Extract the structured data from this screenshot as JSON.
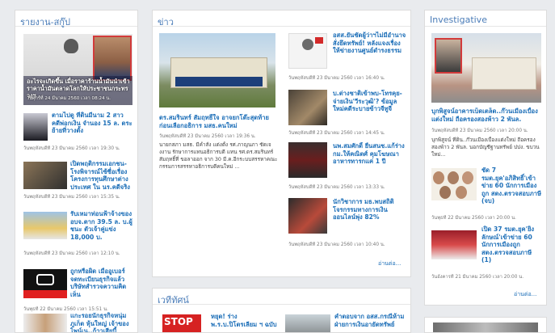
{
  "left": {
    "title": "รายงาน-สกู๊ป",
    "feature": {
      "caption": "อะไรจะเกิดขึ้น เมื่อราคาร้านน้ำมันนำเข้าราคาน้ำมันตลาดโลกให้ประชาชนกระทรวงฯ",
      "date": "วันศุกร์ที่ 24 มีนาคม 2560 เวลา 08:24 น."
    },
    "items": [
      {
        "headline": "ตามไปดู ที่ดินมีนาม 2 สาว คดีพ่อกเงิน จำนอง 15 ล. ตระย้ายที่วางตั้ง",
        "date": "วันพฤหัสบดีที่ 23 มีนาคม 2560 เวลา 19:30 น."
      },
      {
        "headline": "เปิดพฤติกรรมเอกชน-โรงพิจารณ์ไซ้ซื่อเรื่องโครงการทุนศึกษาต่างประเทศ ใน นร.คดีจริงเงิน",
        "date": "วันพฤหัสบดีที่ 23 มีนาคม 2560 เวลา 15:35 น."
      },
      {
        "headline": "รับเหมาท่อนฟ้าจ้างของ อบจ.ตาก 39.5 ล. บ.ผู้ชนะ ตัวเจ้าคู่แข่ง 18,000 บ.",
        "date": "วันพฤหัสบดีที่ 23 มีนาคม 2560 เวลา 12:10 น."
      },
      {
        "headline": "ถูกหรือผิด เมื่ออูเบอร์ จดทะเบียนธุรกิจแล้ว บริษัทสำรวจความคิดเห็น",
        "date": "วันพุธที่ 22 มีนาคม 2560 เวลา 15:51 น."
      },
      {
        "headline": "แกะรอยนักธุรกิจหนุ่มภูเก็ต หุ้นใหญ่ เจ้าของไพน์เน..ก้าวเสียบี้",
        "date": ""
      }
    ]
  },
  "middle": {
    "title": "ข่าว",
    "lead": {
      "headline": "ดร.สมรินทร์ สัมฤทธิ์ใจ อาจยกโต๊ะสุดท้ายก่อนเลือกอธิการ มสธ.คนใหม่",
      "date": "วันพฤหัสบดีที่ 23 มีนาคม 2560 เวลา 19:36 น.",
      "excerpt": "นายกสภา มสธ. มีคำสั่ง แต่งตั้ง รศ.ภาญนภา ชัดเจงงาน รักษาการแทนอธิการบดี แทน รศ.ดร.สมรินทร์ สัมฤทธิ์ที่ ขอลาออก จาก 30 มี.ค.อีกระบบสรรหาคณะกรรมการสรรหาอธิการบดีคนใหม่ ..."
    },
    "items": [
      {
        "headline": "อสส.ยันชัดผู้ว่าฯไม่มีอำนาจสั่งยึดทรัพย์! หลังแจงเรื่องให้ข่ายงานศูนย์ดำรงธรรม",
        "date": "วันพฤหัสบดีที่ 23 มีนาคม 2560 เวลา 16:40 น."
      },
      {
        "headline": "บ.ต่างชาติเข้าพบ-โทรคุย-จ่ายเงิน'วีระวุฒิ'? ข้อมูลใหม่คดีระบายข้าวจีทูจี",
        "date": "วันพฤหัสบดีที่ 23 มีนาคม 2560 เวลา 14:45 น."
      },
      {
        "headline": "นพ.สมศักดิ์ ยื่นสนช.แก้ร่าง กม.ให้คณิตศ์ คุมโฆษณาอาหารทารกแค่ 1 ปี",
        "date": "วันพฤหัสบดีที่ 23 มีนาคม 2560 เวลา 13:33 น."
      },
      {
        "headline": "นักวิชาการ มธ.พบสถิติ โจรกรรมทางการเงินออนไลน์พุ่ง 82%",
        "date": "วันพฤหัสบดีที่ 23 มีนาคม 2560 เวลา 10:40 น."
      }
    ],
    "more": "อ่านต่อ..."
  },
  "forum": {
    "title": "เวทีทัศน์",
    "items": [
      {
        "headline": "หยุด! ร่าง พ.ร.บ.ปิโตรเลียม ฯ ฉบับ"
      },
      {
        "headline": "คำตอบจาก อสส.กรณีห้ามฝ่ายการเงินอายัดทรัพย์"
      }
    ]
  },
  "right": {
    "title": "Investigative",
    "lead": {
      "headline": "บุกพิสูจน์อาคารเบ็ดเตล็ด..ก๊วนเมืองเบื้องแต่งใหม่ ถือครองสองพ้าว 2 พันล.",
      "date": "วันพฤหัสบดีที่ 23 มีนาคม 2560 เวลา 20:00 น.",
      "excerpt": "บุกพิสูจน์ ที่ดิน..ก๊วนเมืองเบื้องแต่งใหม่ ถือครองสองพ้าว 2 พันล. นอกบัญชีฐานทรัพย์ ปปง. ขบวนใหม่..."
    },
    "items": [
      {
        "headline": "ชัด 7 รมต.ยุค'อภิสิทธิ์'เข้าข่าย 60 นักการเมืองถูก สตง.ตรวจสอบภาษี (จบ)",
        "date": "วันพุธที่ 22 มีนาคม 2560 เวลา 20:00 น."
      },
      {
        "headline": "เปิด 37 รมต.ยุค'ยิ่งลักษณ์'เข้าข่าย 60 นักการเมืองถูก สตง.ตรวจสอบภาษี (1)",
        "date": "วันอังคารที่ 21 มีนาคม 2560 เวลา 20:00 น."
      }
    ],
    "more": "อ่านต่อ..."
  }
}
